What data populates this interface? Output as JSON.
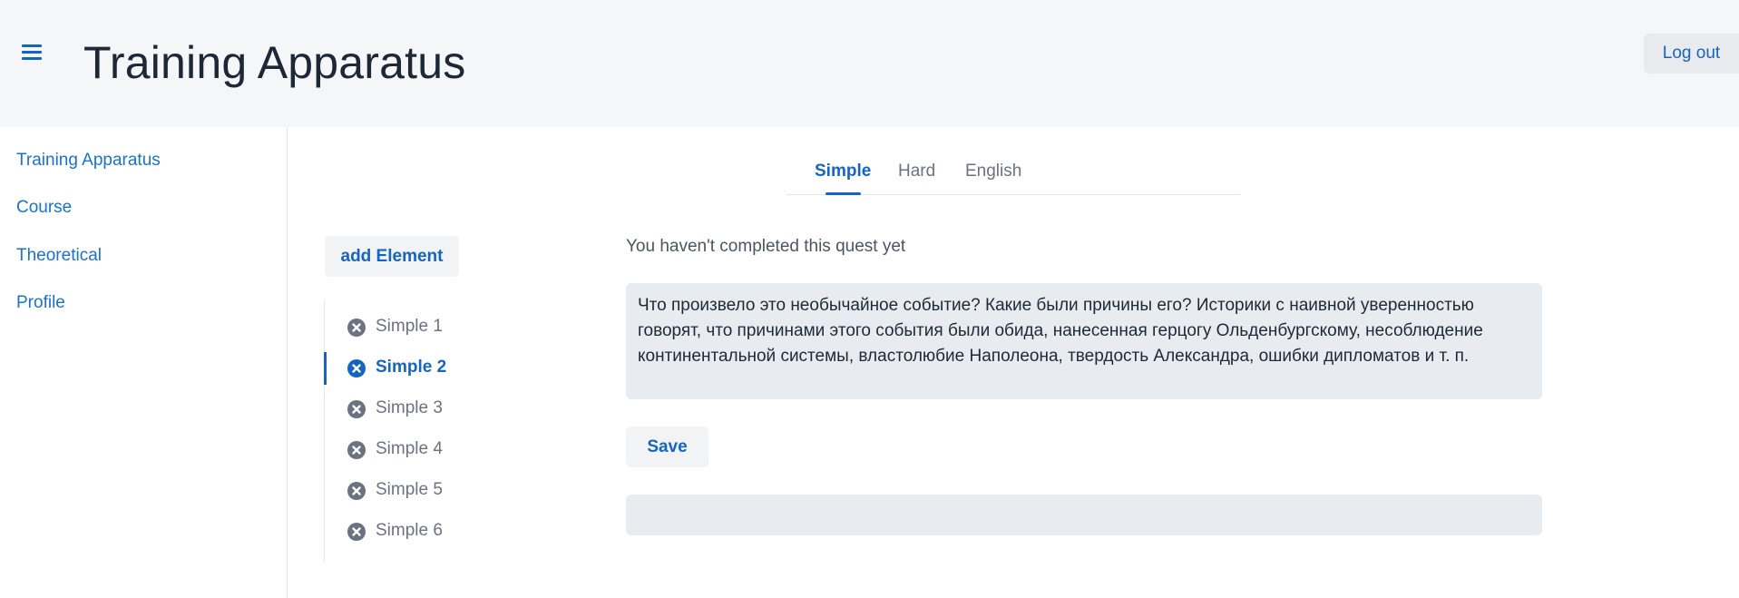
{
  "header": {
    "title": "Training Apparatus",
    "logout_label": "Log out",
    "menu_icon": "hamburger-menu-icon"
  },
  "sidebar": {
    "items": [
      {
        "label": "Training Apparatus"
      },
      {
        "label": "Course"
      },
      {
        "label": "Theoretical"
      },
      {
        "label": "Profile"
      }
    ]
  },
  "tabs": [
    {
      "label": "Simple",
      "active": true
    },
    {
      "label": "Hard",
      "active": false
    },
    {
      "label": "English",
      "active": false
    }
  ],
  "elements": {
    "add_label": "add Element",
    "items": [
      {
        "label": "Simple 1",
        "icon": "close-circle-icon",
        "active": false
      },
      {
        "label": "Simple 2",
        "icon": "close-circle-icon",
        "active": true
      },
      {
        "label": "Simple 3",
        "icon": "close-circle-icon",
        "active": false
      },
      {
        "label": "Simple 4",
        "icon": "close-circle-icon",
        "active": false
      },
      {
        "label": "Simple 5",
        "icon": "close-circle-icon",
        "active": false
      },
      {
        "label": "Simple 6",
        "icon": "close-circle-icon",
        "active": false
      }
    ]
  },
  "main": {
    "status": "You haven't completed this quest yet",
    "quest_text": "Что произвело это необычайное событие? Какие были причины его? Историки с наивной уверенностью говорят, что причинами этого события были обида, нанесенная герцогу Ольденбургскому, несоблюдение континентальной системы, властолюбие Наполеона, твердость Александра, ошибки дипломатов и т. п.",
    "save_label": "Save",
    "answer_value": ""
  },
  "colors": {
    "accent": "#1565c0",
    "header_bg": "#f5f6f8",
    "muted": "#6b7280",
    "field_bg": "#e8ebef"
  }
}
